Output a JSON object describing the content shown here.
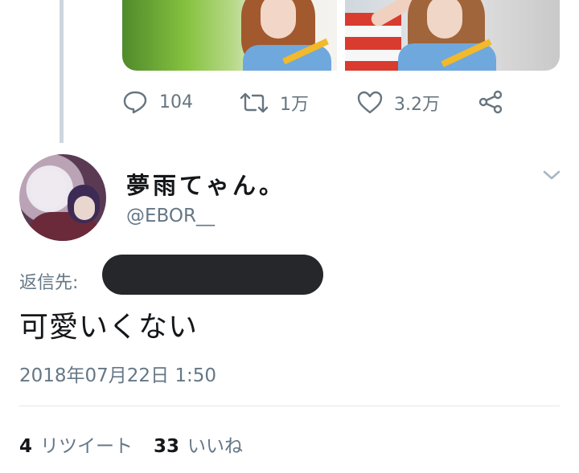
{
  "actions": {
    "reply_count": "104",
    "retweet_count": "1万",
    "like_count": "3.2万"
  },
  "reply_tweet": {
    "display_name": "夢雨てゃん。",
    "handle": "@EBOR__",
    "reply_to_label": "返信先:",
    "text": "可愛いくない",
    "timestamp": "2018年07月22日 1:50",
    "retweet_count": "4",
    "retweet_label": "リツイート",
    "like_count": "33",
    "like_label": "いいね"
  },
  "colors": {
    "text_primary": "#14171a",
    "text_secondary": "#657786",
    "icon": "#66757f",
    "thread_line": "#cdd6de",
    "redaction": "#25272b"
  }
}
